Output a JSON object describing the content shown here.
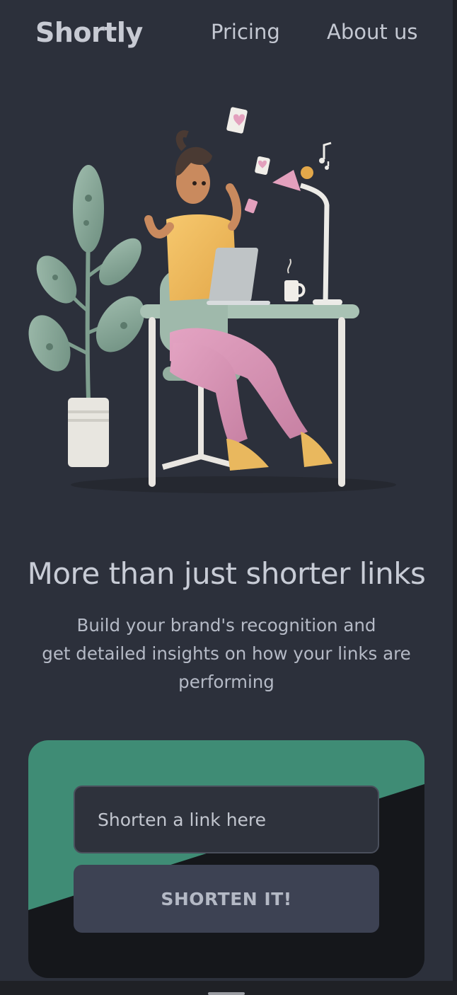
{
  "header": {
    "logo": "Shortly",
    "nav": [
      {
        "label": "Pricing"
      },
      {
        "label": "About us"
      }
    ]
  },
  "hero": {
    "illustration": "person-working-at-desk-illustration",
    "title": "More than just shorter links",
    "subtitle_line1": "Build your brand's recognition and",
    "subtitle_line2": "get detailed insights on how your links are",
    "subtitle_line3": "performing"
  },
  "shorten": {
    "placeholder": "Shorten a link here",
    "button_label": "SHORTEN IT!",
    "colors": {
      "accent": "#3f8c75",
      "card": "#15171b",
      "button": "#3d4253"
    }
  }
}
